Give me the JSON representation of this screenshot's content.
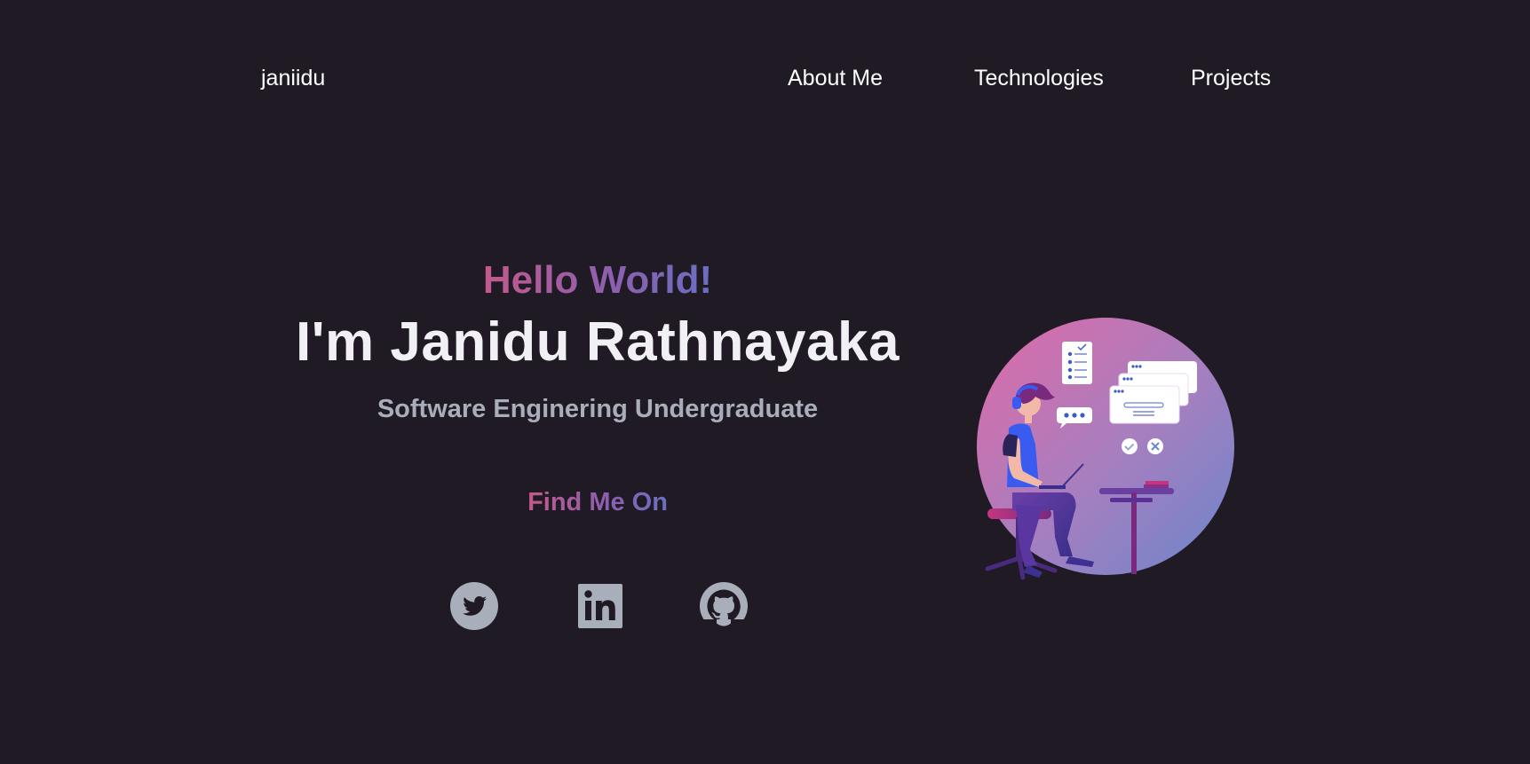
{
  "nav": {
    "logo": "janiidu",
    "links": [
      "About Me",
      "Technologies",
      "Projects"
    ]
  },
  "hero": {
    "greeting": "Hello World!",
    "name": "I'm Janidu Rathnayaka",
    "role": "Software Enginering Undergraduate",
    "find_me": "Find Me On"
  },
  "socials": [
    {
      "icon": "twitter-icon"
    },
    {
      "icon": "linkedin-icon"
    },
    {
      "icon": "github-icon"
    }
  ],
  "colors": {
    "background": "#1f1a24",
    "gradient_start": "#c25a8c",
    "gradient_end": "#6a6fc2",
    "icon_gray": "#a9aebb"
  }
}
